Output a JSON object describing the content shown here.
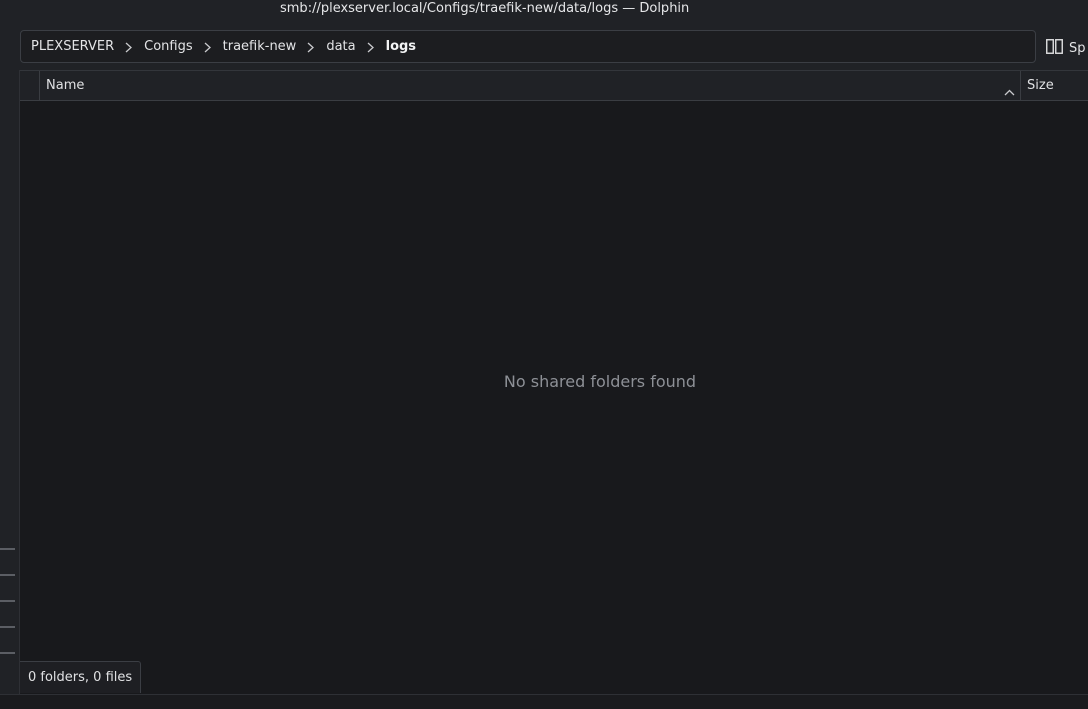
{
  "window": {
    "title": "smb://plexserver.local/Configs/traefik-new/data/logs — Dolphin"
  },
  "breadcrumb": {
    "items": [
      {
        "label": "PLEXSERVER"
      },
      {
        "label": "Configs"
      },
      {
        "label": "traefik-new"
      },
      {
        "label": "data"
      },
      {
        "label": "logs"
      }
    ]
  },
  "toolbar": {
    "split_label": "Sp",
    "split_icon": "split-view-icon"
  },
  "columns": {
    "name": "Name",
    "size": "Size",
    "sort_icon": "sort-ascending-icon"
  },
  "view": {
    "empty_message": "No shared folders found"
  },
  "status": {
    "text": "0 folders, 0 files"
  },
  "colors": {
    "background": "#18191c",
    "panel": "#202226",
    "text": "#e0e1e3",
    "muted_text": "#8d9096"
  }
}
